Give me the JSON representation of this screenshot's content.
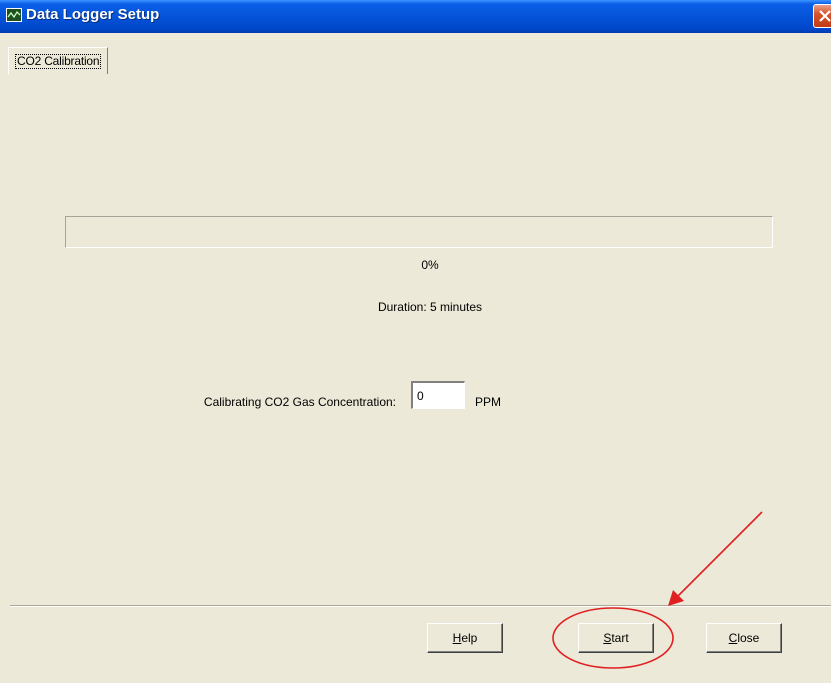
{
  "window": {
    "title": "Data Logger Setup"
  },
  "tabs": [
    {
      "label": "CO2 Calibration",
      "active": true
    }
  ],
  "progress": {
    "value_percent": 0,
    "label": "0%"
  },
  "duration": {
    "label": "Duration: 5 minutes"
  },
  "concentration": {
    "label": "Calibrating CO2 Gas  Concentration:",
    "value": "0",
    "unit": "PPM"
  },
  "buttons": {
    "help": {
      "mnemonic": "H",
      "rest": "elp"
    },
    "start": {
      "mnemonic": "S",
      "rest": "tart"
    },
    "close": {
      "mnemonic": "C",
      "rest": "lose"
    }
  },
  "colors": {
    "titlebar": "#0553d8",
    "window_bg": "#ece9d8",
    "annotation": "#e02020",
    "close_button": "#d6542c"
  },
  "icons": {
    "app": "chart-line-icon",
    "close": "close-icon"
  }
}
